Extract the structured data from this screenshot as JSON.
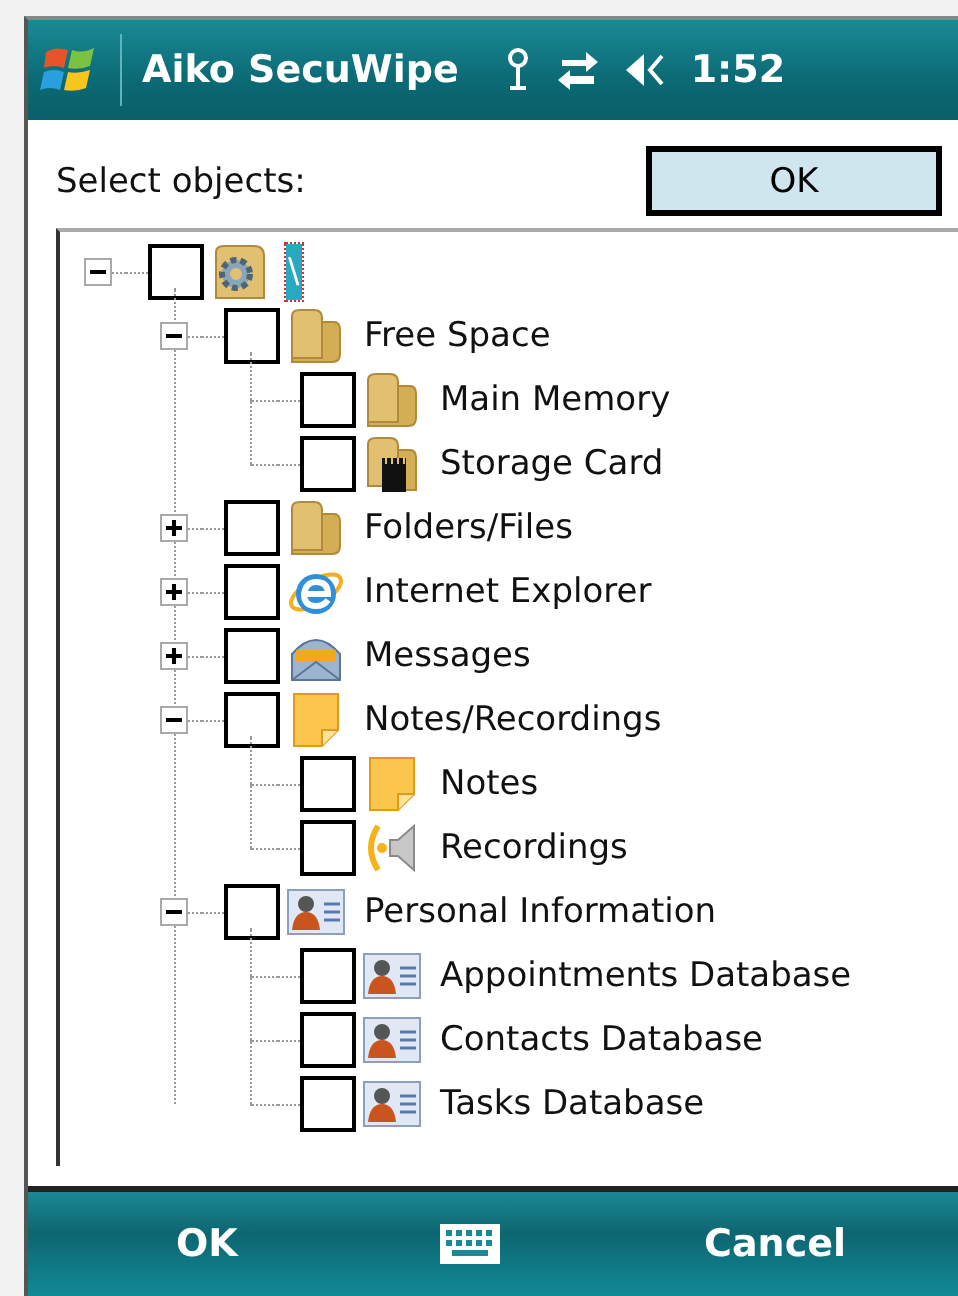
{
  "title_bar": {
    "title": "Aiko SecuWipe",
    "time": "1:52"
  },
  "prompt": "Select objects:",
  "ok_button": "OK",
  "tree": [
    {
      "label": "\\",
      "kind": "drive",
      "checked": false,
      "selected": true,
      "expanded": true,
      "children": [
        {
          "label": "Free Space",
          "kind": "folder",
          "checked": false,
          "selected": false,
          "expanded": true,
          "children": [
            {
              "label": "Main Memory",
              "kind": "folder",
              "checked": false,
              "selected": false
            },
            {
              "label": "Storage Card",
              "kind": "card",
              "checked": false,
              "selected": false
            }
          ]
        },
        {
          "label": "Folders/Files",
          "kind": "folder",
          "checked": false,
          "selected": false,
          "expanded": false
        },
        {
          "label": "Internet Explorer",
          "kind": "browser",
          "checked": false,
          "selected": false,
          "expanded": false
        },
        {
          "label": "Messages",
          "kind": "mail",
          "checked": false,
          "selected": false,
          "expanded": false
        },
        {
          "label": "Notes/Recordings",
          "kind": "note",
          "checked": false,
          "selected": false,
          "expanded": true,
          "children": [
            {
              "label": "Notes",
              "kind": "note",
              "checked": false,
              "selected": false
            },
            {
              "label": "Recordings",
              "kind": "sound",
              "checked": false,
              "selected": false
            }
          ]
        },
        {
          "label": "Personal Information",
          "kind": "contact",
          "checked": false,
          "selected": false,
          "expanded": true,
          "children": [
            {
              "label": "Appointments Database",
              "kind": "contact",
              "checked": false,
              "selected": false
            },
            {
              "label": "Contacts Database",
              "kind": "contact",
              "checked": false,
              "selected": false
            },
            {
              "label": "Tasks Database",
              "kind": "contact",
              "checked": false,
              "selected": false
            }
          ]
        }
      ]
    }
  ],
  "softkeys": {
    "left": "OK",
    "right": "Cancel"
  }
}
